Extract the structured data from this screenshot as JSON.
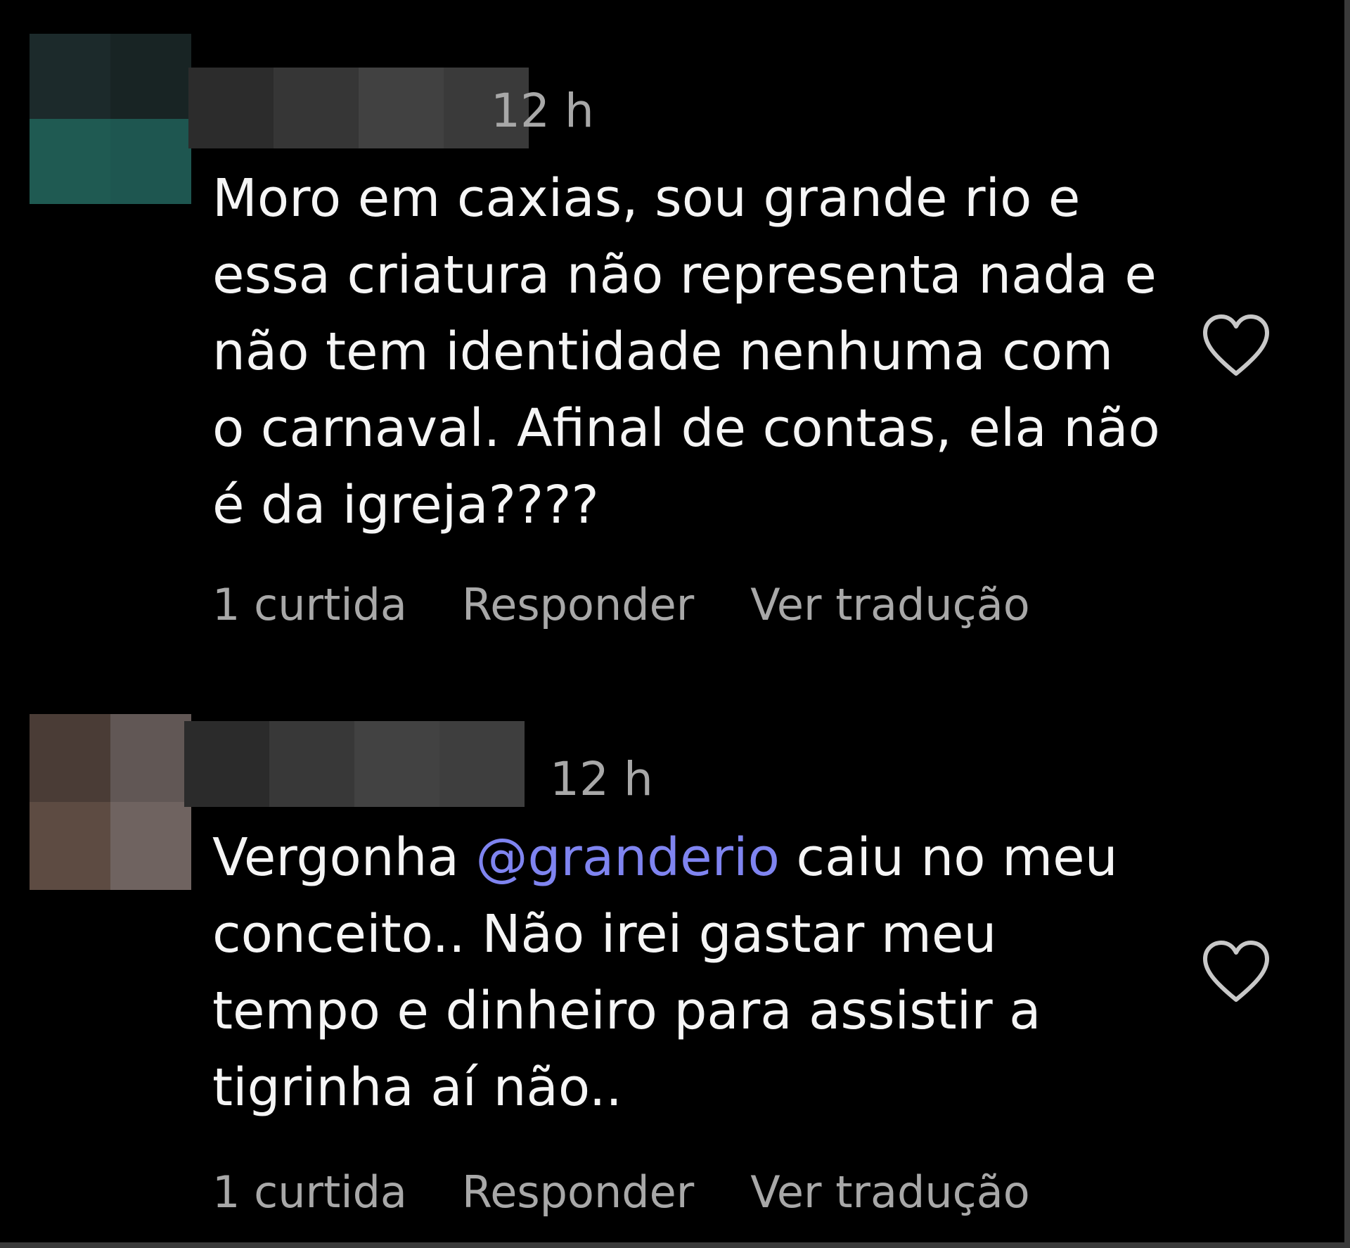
{
  "comments": [
    {
      "time": "12 h",
      "text": "Moro em caxias, sou grande rio e\nessa criatura não representa nada e\nnão tem identidade nenhuma com\no carnaval. Afinal de contas, ela não\né da igreja????",
      "likes": "1 curtida",
      "reply_label": "Responder",
      "translate_label": "Ver tradução",
      "avatar_colors": [
        "#1c2a2b",
        "#182424",
        "#1f5a52",
        "#1e5650"
      ],
      "name_blur_colors": [
        "#2c2c2c",
        "#363636",
        "#414141",
        "#3a3a3a"
      ],
      "heart_icon": "heart-outline-icon"
    },
    {
      "time": "12 h",
      "text_before": "Vergonha ",
      "mention": "@granderio",
      "text_after": " caiu no meu\nconceito.. Não irei gastar meu\ntempo e dinheiro para assistir a\ntigrinha aí não..",
      "likes": "1 curtida",
      "reply_label": "Responder",
      "translate_label": "Ver tradução",
      "avatar_colors": [
        "#4a3c36",
        "#615755",
        "#5d4b42",
        "#6f6360"
      ],
      "name_blur_colors": [
        "#2b2b2b",
        "#383838",
        "#424242",
        "#3e3e3e"
      ],
      "mention_color": "#7f84f0",
      "heart_icon": "heart-outline-icon"
    }
  ]
}
